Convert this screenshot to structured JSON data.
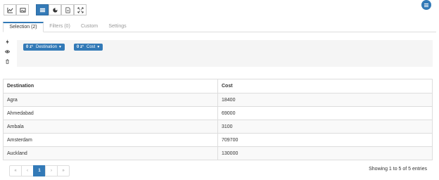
{
  "toolbar": {
    "left_group": [
      {
        "icon": "line-chart-icon"
      },
      {
        "icon": "image-icon"
      }
    ],
    "right_group": [
      {
        "icon": "table-icon",
        "active": true
      },
      {
        "icon": "pie-chart-icon",
        "active": false
      },
      {
        "icon": "document-icon",
        "active": false
      },
      {
        "icon": "expand-icon",
        "active": false
      }
    ],
    "menu_icon": "hamburger-menu-icon"
  },
  "tabs": [
    {
      "label": "Selection (2)",
      "active": true
    },
    {
      "label": "Filters (0)",
      "active": false
    },
    {
      "label": "Custom",
      "active": false
    },
    {
      "label": "Settings",
      "active": false
    }
  ],
  "side_icons": [
    "bolt-icon",
    "eye-icon",
    "trash-icon"
  ],
  "chips": [
    {
      "sort": "0 z¹",
      "label": "Destination",
      "caret": "▼"
    },
    {
      "sort": "0 z¹",
      "label": "Cost",
      "caret": "▼"
    }
  ],
  "table": {
    "columns": [
      "Destination",
      "Cost"
    ],
    "rows": [
      [
        "Agra",
        "18400"
      ],
      [
        "Ahmedabad",
        "69000"
      ],
      [
        "Ambala",
        "3100"
      ],
      [
        "Amsterdam",
        "709700"
      ],
      [
        "Auckland",
        "130000"
      ]
    ]
  },
  "pagination": {
    "first": "«",
    "prev": "‹",
    "current": "1",
    "next": "›",
    "last": "»"
  },
  "entries_info": "Showing 1 to 5 of 5 entries",
  "colors": {
    "accent": "#337ab7",
    "border": "#dddddd",
    "panel": "#f5f5f5"
  }
}
